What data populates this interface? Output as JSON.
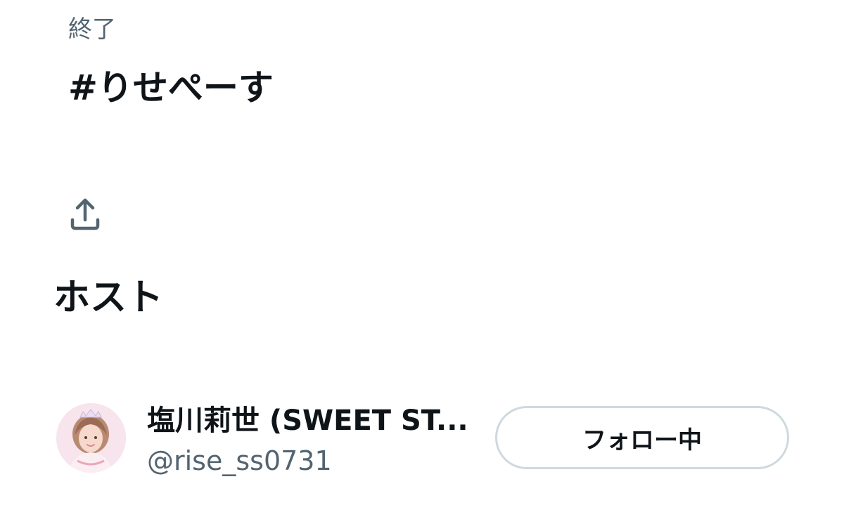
{
  "space": {
    "status": "終了",
    "title": "#りせぺーす"
  },
  "share": {
    "icon": "share-upload-icon"
  },
  "host_section": {
    "heading": "ホスト"
  },
  "host": {
    "name": "塩川莉世 (SWEET ST...",
    "handle": "@rise_ss0731",
    "avatar_icon": "profile-avatar",
    "follow_button_label": "フォロー中"
  },
  "colors": {
    "primary_text": "#0f1419",
    "secondary_text": "#536471",
    "border": "#cfd9de",
    "background": "#ffffff"
  }
}
